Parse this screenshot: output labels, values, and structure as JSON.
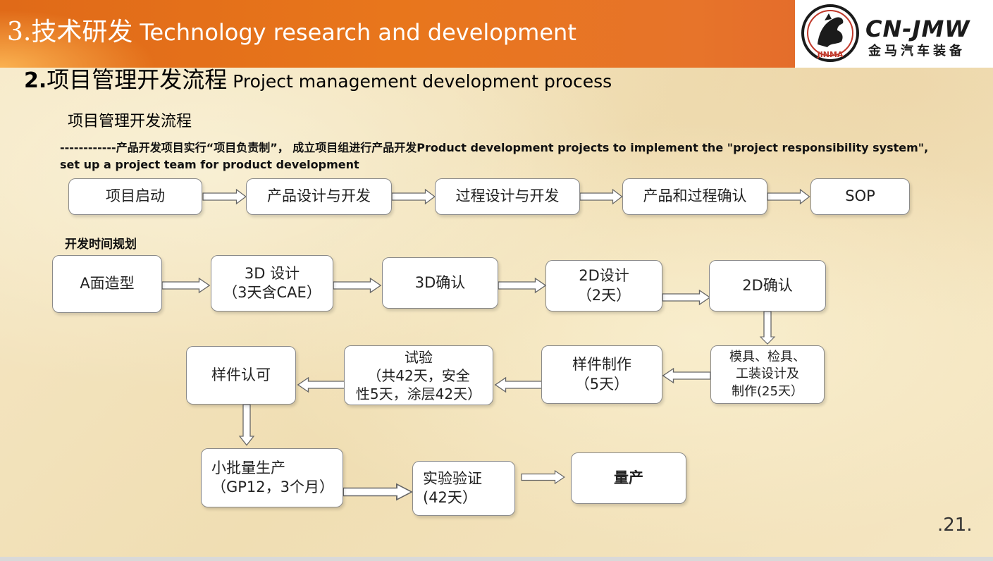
{
  "header": {
    "title_cn": "3.技术研发",
    "title_en": "Technology research and development",
    "logo_en": "CN-JMW",
    "logo_cn": "金马汽车装备",
    "logo_badge": "JINMA"
  },
  "section": {
    "number": "2.",
    "title_cn": "项目管理开发流程",
    "title_en": "Project management development process",
    "subtitle": "项目管理开发流程"
  },
  "description": "------------产品开发项目实行“项目负责制”， 成立项目组进行产品开发Product development projects to implement the \"project responsibility system\", set up a project team for product development",
  "top_flow": [
    "项目启动",
    "产品设计与开发",
    "过程设计与开发",
    "产品和过程确认",
    "SOP"
  ],
  "plan_label": "开发时间规划",
  "timeline": {
    "a_surface": "A面造型",
    "design_3d": "3D 设计\n（3天含CAE）",
    "confirm_3d": "3D确认",
    "design_2d": "2D设计\n（2天）",
    "confirm_2d": "2D确认",
    "tooling": "模具、检具、\n工装设计及\n制作(25天）",
    "sample_make": "样件制作\n（5天）",
    "test": "试验\n（共42天，安全\n性5天，涂层42天）",
    "sample_approve": "样件认可",
    "small_batch": "小批量生产\n（GP12，3个月）",
    "verify": "实验验证\n(42天）",
    "mass": "量产"
  },
  "page_number": ".21."
}
